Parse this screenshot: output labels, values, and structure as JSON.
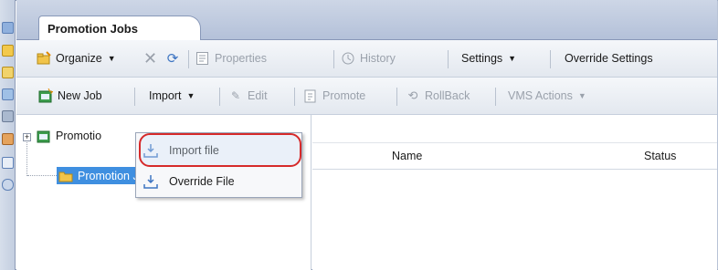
{
  "tab": {
    "title": "Promotion Jobs"
  },
  "toolbar1": {
    "organize": "Organize",
    "properties": "Properties",
    "history": "History",
    "settings": "Settings",
    "override_settings": "Override Settings"
  },
  "toolbar2": {
    "new_job": "New Job",
    "import": "Import",
    "edit": "Edit",
    "promote": "Promote",
    "rollback": "RollBack",
    "vms_actions": "VMS Actions"
  },
  "menu": {
    "items": [
      {
        "label": "Import file",
        "highlighted": true
      },
      {
        "label": "Override File"
      }
    ]
  },
  "tree": {
    "root_label": "Promotio",
    "child_label": "Promotion Jobs"
  },
  "grid": {
    "columns": [
      "Name",
      "Status"
    ]
  },
  "colors": {
    "accent": "#d62a2a",
    "selected": "#3f8fe0",
    "band": "#b4c1d9"
  },
  "icons": [
    "organize-icon",
    "delete-icon",
    "refresh-icon",
    "properties-icon",
    "history-icon",
    "new-job-icon",
    "edit-icon",
    "promote-icon",
    "rollback-icon",
    "import-file-icon",
    "override-file-icon",
    "folder-icon"
  ]
}
